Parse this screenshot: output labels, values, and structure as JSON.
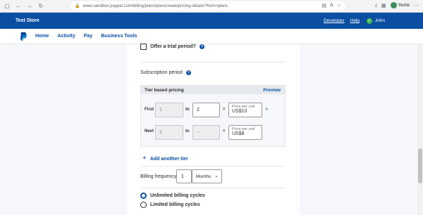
{
  "browser": {
    "url_host": "www.sandbox.paypal.com",
    "url_path": "/billing/plans/plan/create/pricing-details?from=plans",
    "profile_name": "Yeshe"
  },
  "sandbox_header": {
    "store_name": "Test Store",
    "developer_link": "Developer",
    "help_link": "Help",
    "user_name": "John"
  },
  "nav": {
    "items": [
      "Home",
      "Activity",
      "Pay",
      "Business Tools"
    ]
  },
  "form": {
    "trial_label": "Offer a trial period?",
    "subscription_label": "Subscription period",
    "tier_box": {
      "title": "Tier based pricing",
      "preview": "Preview",
      "rows": [
        {
          "label": "First",
          "from": "1",
          "to_sep": "to",
          "to": "2",
          "eq": "=",
          "price_placeholder": "Price per unit",
          "price": "US$10",
          "remove": "×"
        },
        {
          "label": "Next",
          "from": "3",
          "to_sep": "to",
          "to": "--",
          "eq": "=",
          "price_placeholder": "Price per unit",
          "price": "US$8"
        }
      ]
    },
    "add_tier": "Add another tier",
    "billing_label": "Billing frequency",
    "billing_value": "1",
    "billing_unit": "Months",
    "cycles": [
      {
        "label": "Unlimited billing cycles",
        "selected": true
      },
      {
        "label": "Limited billing cycles",
        "selected": false
      }
    ]
  }
}
